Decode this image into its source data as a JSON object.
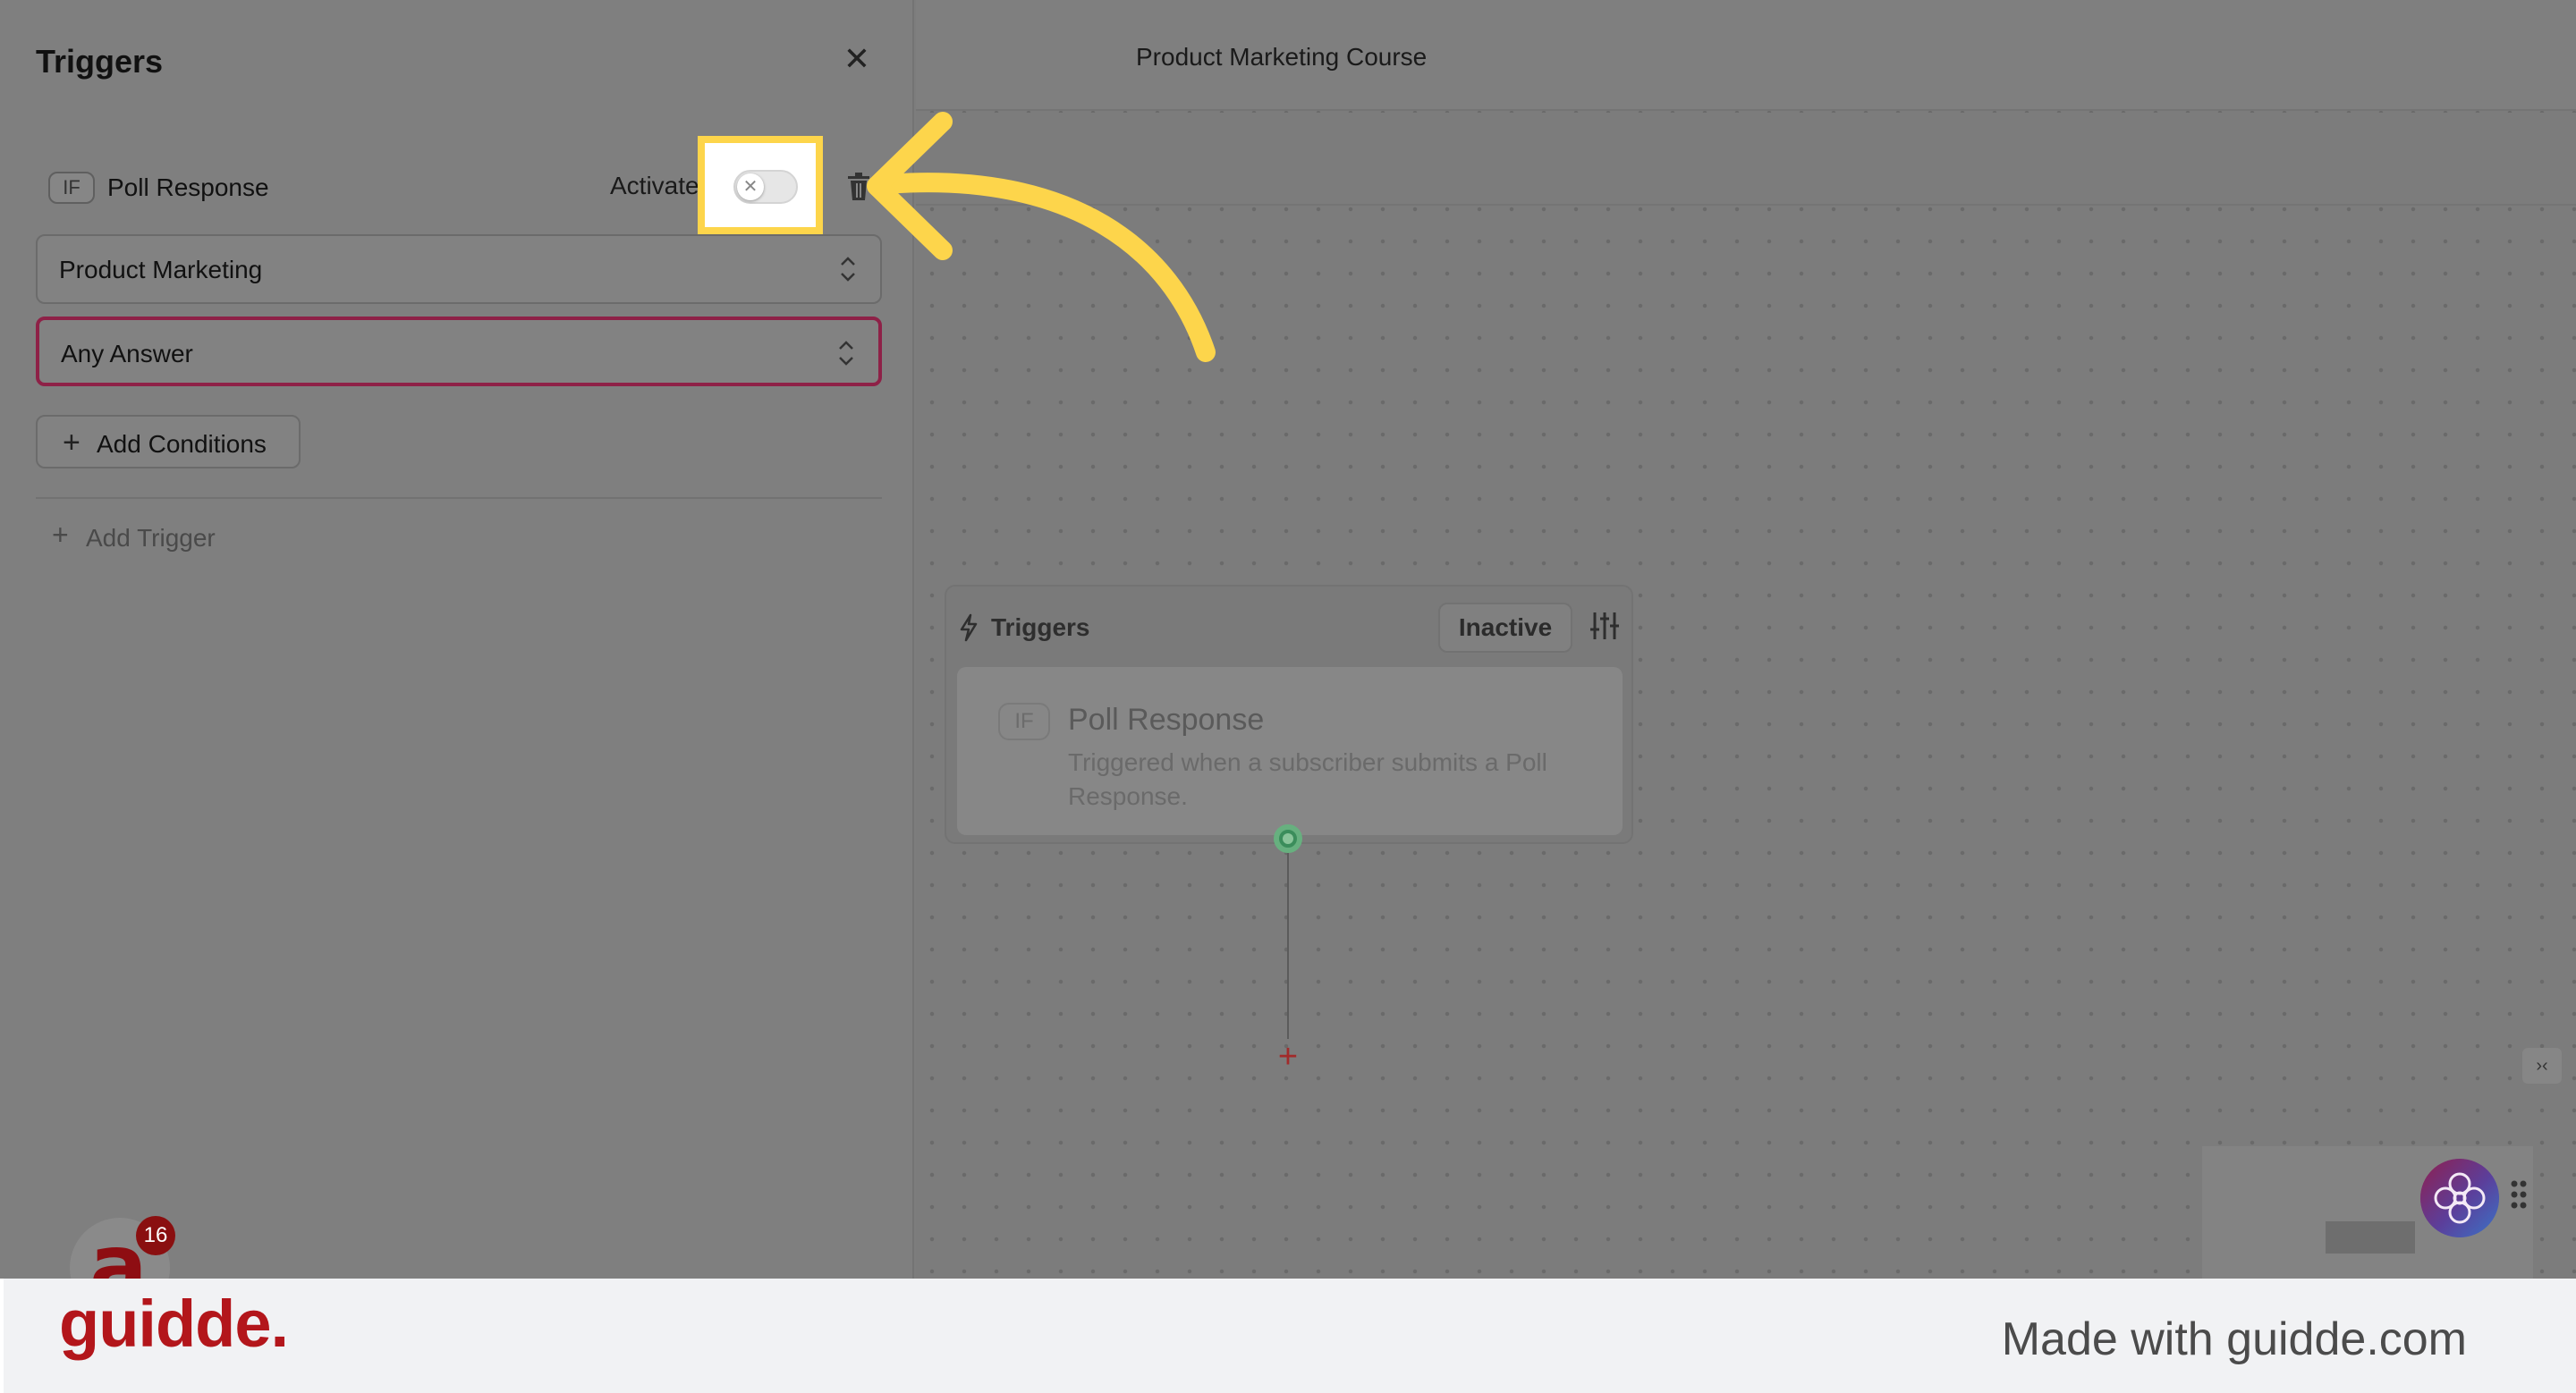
{
  "panel": {
    "title": "Triggers",
    "close_icon": "close-icon",
    "trigger": {
      "badge": "IF",
      "name": "Poll Response",
      "activate_label": "Activate",
      "toggle_state": "off",
      "toggle_icon": "x-icon",
      "delete_icon": "trash-icon"
    },
    "poll_select": {
      "value": "Product Marketing",
      "icon": "chevron-updown-icon"
    },
    "answer_select": {
      "value": "Any Answer",
      "icon": "chevron-updown-icon"
    },
    "add_conditions": {
      "icon": "plus-icon",
      "label": "Add Conditions"
    },
    "add_trigger": {
      "icon": "plus-icon",
      "label": "Add Trigger"
    }
  },
  "app_avatar": {
    "letter": "a",
    "notifications": "16",
    "color": "#8e0d12"
  },
  "header": {
    "course_title": "Product Marketing Course"
  },
  "canvas": {
    "node": {
      "icon": "lightning-icon",
      "title": "Triggers",
      "status": "Inactive",
      "settings_icon": "sliders-icon",
      "card": {
        "badge": "IF",
        "title": "Poll Response",
        "description": "Triggered when a subscriber submits a Poll Response."
      }
    },
    "add_step_icon": "plus-icon",
    "collapse_icon": "collapse-icon"
  },
  "footer": {
    "brand": "guidde.",
    "made_with": "Made with guidde.com",
    "brand_color": "#b3161b"
  },
  "colors": {
    "highlight": "#fdd54b",
    "focus_border": "#8e2147",
    "connector": "#3b8d5b"
  }
}
